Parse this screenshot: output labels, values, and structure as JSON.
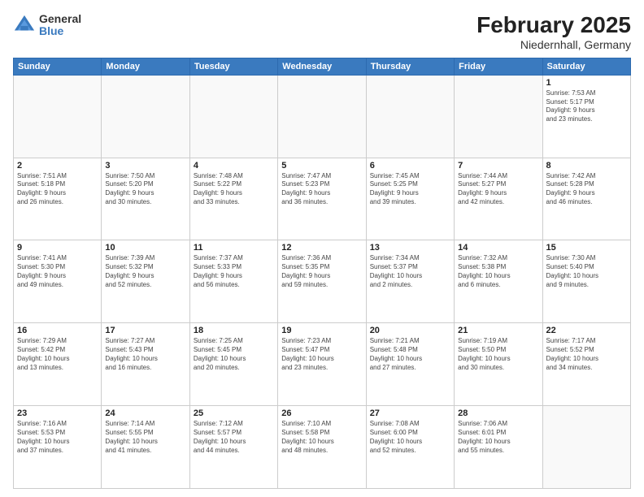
{
  "header": {
    "logo_general": "General",
    "logo_blue": "Blue",
    "month_title": "February 2025",
    "location": "Niedernhall, Germany"
  },
  "days_of_week": [
    "Sunday",
    "Monday",
    "Tuesday",
    "Wednesday",
    "Thursday",
    "Friday",
    "Saturday"
  ],
  "weeks": [
    [
      {
        "day": "",
        "info": ""
      },
      {
        "day": "",
        "info": ""
      },
      {
        "day": "",
        "info": ""
      },
      {
        "day": "",
        "info": ""
      },
      {
        "day": "",
        "info": ""
      },
      {
        "day": "",
        "info": ""
      },
      {
        "day": "1",
        "info": "Sunrise: 7:53 AM\nSunset: 5:17 PM\nDaylight: 9 hours\nand 23 minutes."
      }
    ],
    [
      {
        "day": "2",
        "info": "Sunrise: 7:51 AM\nSunset: 5:18 PM\nDaylight: 9 hours\nand 26 minutes."
      },
      {
        "day": "3",
        "info": "Sunrise: 7:50 AM\nSunset: 5:20 PM\nDaylight: 9 hours\nand 30 minutes."
      },
      {
        "day": "4",
        "info": "Sunrise: 7:48 AM\nSunset: 5:22 PM\nDaylight: 9 hours\nand 33 minutes."
      },
      {
        "day": "5",
        "info": "Sunrise: 7:47 AM\nSunset: 5:23 PM\nDaylight: 9 hours\nand 36 minutes."
      },
      {
        "day": "6",
        "info": "Sunrise: 7:45 AM\nSunset: 5:25 PM\nDaylight: 9 hours\nand 39 minutes."
      },
      {
        "day": "7",
        "info": "Sunrise: 7:44 AM\nSunset: 5:27 PM\nDaylight: 9 hours\nand 42 minutes."
      },
      {
        "day": "8",
        "info": "Sunrise: 7:42 AM\nSunset: 5:28 PM\nDaylight: 9 hours\nand 46 minutes."
      }
    ],
    [
      {
        "day": "9",
        "info": "Sunrise: 7:41 AM\nSunset: 5:30 PM\nDaylight: 9 hours\nand 49 minutes."
      },
      {
        "day": "10",
        "info": "Sunrise: 7:39 AM\nSunset: 5:32 PM\nDaylight: 9 hours\nand 52 minutes."
      },
      {
        "day": "11",
        "info": "Sunrise: 7:37 AM\nSunset: 5:33 PM\nDaylight: 9 hours\nand 56 minutes."
      },
      {
        "day": "12",
        "info": "Sunrise: 7:36 AM\nSunset: 5:35 PM\nDaylight: 9 hours\nand 59 minutes."
      },
      {
        "day": "13",
        "info": "Sunrise: 7:34 AM\nSunset: 5:37 PM\nDaylight: 10 hours\nand 2 minutes."
      },
      {
        "day": "14",
        "info": "Sunrise: 7:32 AM\nSunset: 5:38 PM\nDaylight: 10 hours\nand 6 minutes."
      },
      {
        "day": "15",
        "info": "Sunrise: 7:30 AM\nSunset: 5:40 PM\nDaylight: 10 hours\nand 9 minutes."
      }
    ],
    [
      {
        "day": "16",
        "info": "Sunrise: 7:29 AM\nSunset: 5:42 PM\nDaylight: 10 hours\nand 13 minutes."
      },
      {
        "day": "17",
        "info": "Sunrise: 7:27 AM\nSunset: 5:43 PM\nDaylight: 10 hours\nand 16 minutes."
      },
      {
        "day": "18",
        "info": "Sunrise: 7:25 AM\nSunset: 5:45 PM\nDaylight: 10 hours\nand 20 minutes."
      },
      {
        "day": "19",
        "info": "Sunrise: 7:23 AM\nSunset: 5:47 PM\nDaylight: 10 hours\nand 23 minutes."
      },
      {
        "day": "20",
        "info": "Sunrise: 7:21 AM\nSunset: 5:48 PM\nDaylight: 10 hours\nand 27 minutes."
      },
      {
        "day": "21",
        "info": "Sunrise: 7:19 AM\nSunset: 5:50 PM\nDaylight: 10 hours\nand 30 minutes."
      },
      {
        "day": "22",
        "info": "Sunrise: 7:17 AM\nSunset: 5:52 PM\nDaylight: 10 hours\nand 34 minutes."
      }
    ],
    [
      {
        "day": "23",
        "info": "Sunrise: 7:16 AM\nSunset: 5:53 PM\nDaylight: 10 hours\nand 37 minutes."
      },
      {
        "day": "24",
        "info": "Sunrise: 7:14 AM\nSunset: 5:55 PM\nDaylight: 10 hours\nand 41 minutes."
      },
      {
        "day": "25",
        "info": "Sunrise: 7:12 AM\nSunset: 5:57 PM\nDaylight: 10 hours\nand 44 minutes."
      },
      {
        "day": "26",
        "info": "Sunrise: 7:10 AM\nSunset: 5:58 PM\nDaylight: 10 hours\nand 48 minutes."
      },
      {
        "day": "27",
        "info": "Sunrise: 7:08 AM\nSunset: 6:00 PM\nDaylight: 10 hours\nand 52 minutes."
      },
      {
        "day": "28",
        "info": "Sunrise: 7:06 AM\nSunset: 6:01 PM\nDaylight: 10 hours\nand 55 minutes."
      },
      {
        "day": "",
        "info": ""
      }
    ]
  ]
}
